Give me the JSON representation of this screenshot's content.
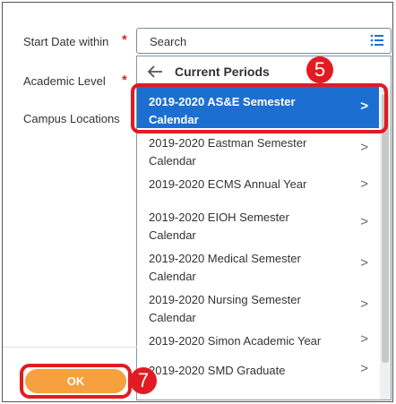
{
  "form": {
    "fields": [
      {
        "label": "Start Date within",
        "required": true
      },
      {
        "label": "Academic Level",
        "required": true
      },
      {
        "label": "Campus Locations",
        "required": false
      }
    ],
    "required_mark": "*"
  },
  "search": {
    "placeholder": "Search",
    "icon": "list-icon"
  },
  "panel": {
    "title": "Current Periods",
    "back_icon": "arrow-left-icon",
    "items": [
      {
        "line1": "2019-2020 AS&E Semester",
        "line2": "Calendar",
        "selected": true
      },
      {
        "line1": "2019-2020 Eastman Semester",
        "line2": "Calendar"
      },
      {
        "line1": "2019-2020 ECMS Annual Year",
        "line2": ""
      },
      {
        "line1": "2019-2020 EIOH Semester",
        "line2": "Calendar"
      },
      {
        "line1": "2019-2020 Medical Semester",
        "line2": "Calendar"
      },
      {
        "line1": "2019-2020 Nursing Semester",
        "line2": "Calendar"
      },
      {
        "line1": "2019-2020 Simon Academic Year",
        "line2": ""
      },
      {
        "line1": "2019-2020 SMD Graduate",
        "line2": ""
      }
    ],
    "chevron": ">"
  },
  "ok_button": {
    "label": "OK"
  },
  "annotations": {
    "step_select": "5",
    "step_ok": "7"
  },
  "colors": {
    "selected_bg": "#1c6fd1",
    "annotation_red": "#e11b22",
    "ok_orange": "#f6a040"
  }
}
